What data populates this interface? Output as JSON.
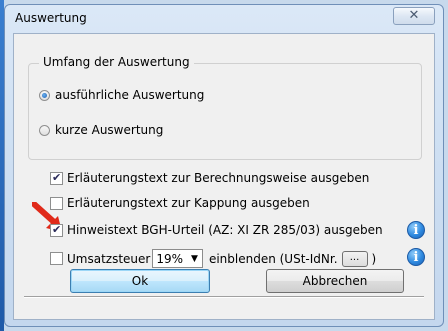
{
  "window": {
    "title": "Auswertung",
    "close_glyph": "✕"
  },
  "group": {
    "legend": "Umfang der Auswertung",
    "options": [
      {
        "label": "ausführliche Auswertung",
        "selected": true
      },
      {
        "label": "kurze Auswertung",
        "selected": false
      }
    ]
  },
  "options": {
    "berechnung": {
      "label": "Erläuterungstext zur Berechnungsweise ausgeben",
      "checked": true
    },
    "kappung": {
      "label": "Erläuterungstext zur Kappung  ausgeben",
      "checked": false
    },
    "bgh": {
      "label": "Hinweistext BGH-Urteil (AZ: XI ZR 285/03) ausgeben",
      "checked": true
    },
    "umsatzsteuer": {
      "label": "Umsatzsteuer",
      "checked": false,
      "rate_value": "19%",
      "suffix": "einblenden  (USt-IdNr.",
      "ellipsis_label": "...",
      "close_paren": ")"
    }
  },
  "buttons": {
    "ok": "Ok",
    "cancel": "Abbrechen"
  },
  "icons": {
    "info_glyph": "i",
    "arrow_color": "#e02a1a"
  }
}
